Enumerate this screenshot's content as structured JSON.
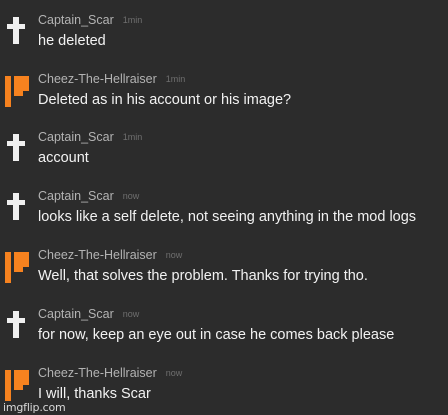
{
  "colors": {
    "background": "#2c2c2c",
    "username": "#b3b3b3",
    "timestamp": "#6f6f6f",
    "message": "#f2f2f2",
    "accent_orange": "#f6821f",
    "cross_white": "#f0f0f0"
  },
  "messages": [
    {
      "user": "Captain_Scar",
      "avatar": "cross-icon",
      "time": "1min",
      "text": "he deleted"
    },
    {
      "user": "Cheez-The-Hellraiser",
      "avatar": "orange-flag-icon",
      "time": "1min",
      "text": "Deleted as in his account or his image?"
    },
    {
      "user": "Captain_Scar",
      "avatar": "cross-icon",
      "time": "1min",
      "text": "account"
    },
    {
      "user": "Captain_Scar",
      "avatar": "cross-icon",
      "time": "now",
      "text": "looks like a self delete, not seeing anything in the mod logs"
    },
    {
      "user": "Cheez-The-Hellraiser",
      "avatar": "orange-flag-icon",
      "time": "now",
      "text": "Well, that solves the problem. Thanks for trying tho."
    },
    {
      "user": "Captain_Scar",
      "avatar": "cross-icon",
      "time": "now",
      "text": "for now, keep an eye out in case he comes back please"
    },
    {
      "user": "Cheez-The-Hellraiser",
      "avatar": "orange-flag-icon",
      "time": "now",
      "text": "I will, thanks Scar"
    }
  ],
  "watermark": "imgflip.com"
}
